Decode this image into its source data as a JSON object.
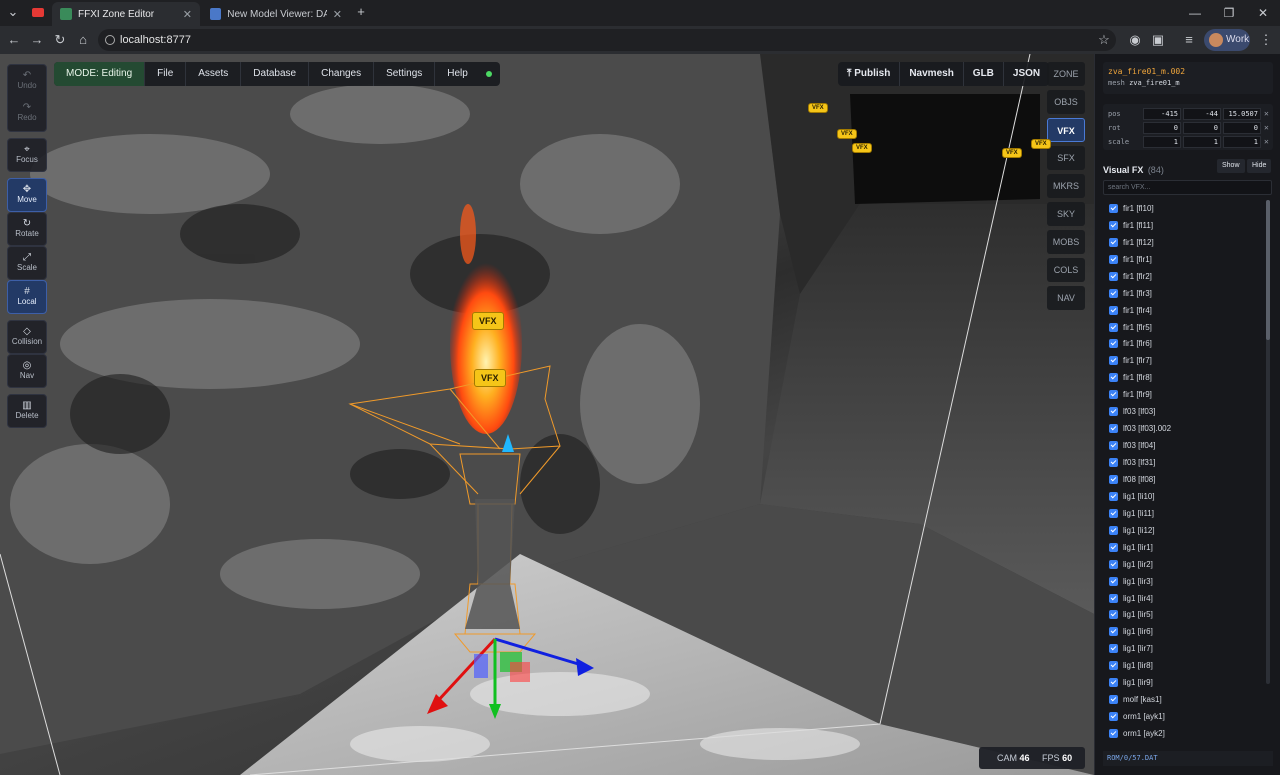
{
  "browser": {
    "tabs": [
      {
        "title": "FFXI Zone Editor",
        "active": true
      },
      {
        "title": "New Model Viewer: DATura - F",
        "active": false
      }
    ],
    "url": "localhost:8777",
    "profile": "Work"
  },
  "tools": {
    "undo": "Undo",
    "redo": "Redo",
    "focus": "Focus",
    "move": "Move",
    "rotate": "Rotate",
    "scale": "Scale",
    "local": "Local",
    "collision": "Collision",
    "nav": "Nav",
    "delete": "Delete"
  },
  "menu": {
    "mode": "MODE: Editing",
    "file": "File",
    "assets": "Assets",
    "database": "Database",
    "changes": "Changes",
    "settings": "Settings",
    "help": "Help"
  },
  "topright": {
    "publish": "Publish",
    "navmesh": "Navmesh",
    "glb": "GLB",
    "json": "JSON"
  },
  "categories": [
    "ZONE",
    "OBJS",
    "VFX",
    "SFX",
    "MKRS",
    "SKY",
    "MOBS",
    "COLS",
    "NAV"
  ],
  "active_category": "VFX",
  "vfx_tag": "VFX",
  "stats": {
    "cam_label": "CAM",
    "cam": "46",
    "fps_label": "FPS",
    "fps": "60"
  },
  "selected": {
    "name": "zva_fire01_m.002",
    "mesh_label": "mesh",
    "mesh": "zva_fire01_m"
  },
  "transform": {
    "pos_label": "pos",
    "pos": [
      "-415",
      "-44",
      "15.0507"
    ],
    "rot_label": "rot",
    "rot": [
      "0",
      "0",
      "0"
    ],
    "scale_label": "scale",
    "scale": [
      "1",
      "1",
      "1"
    ]
  },
  "vfx_panel": {
    "title": "Visual FX",
    "count": "(84)",
    "show": "Show",
    "hide": "Hide",
    "search_placeholder": "search VFX...",
    "items": [
      "fir1 [fl10]",
      "fir1 [fl11]",
      "fir1 [fl12]",
      "fir1 [flr1]",
      "fir1 [flr2]",
      "fir1 [flr3]",
      "fir1 [flr4]",
      "fir1 [flr5]",
      "fir1 [flr6]",
      "fir1 [flr7]",
      "fir1 [flr8]",
      "fir1 [flr9]",
      "lf03 [lf03]",
      "lf03 [lf03].002",
      "lf03 [lf04]",
      "lf03 [lf31]",
      "lf08 [lf08]",
      "lig1 [li10]",
      "lig1 [li11]",
      "lig1 [li12]",
      "lig1 [lir1]",
      "lig1 [lir2]",
      "lig1 [lir3]",
      "lig1 [lir4]",
      "lig1 [lir5]",
      "lig1 [lir6]",
      "lig1 [lir7]",
      "lig1 [lir8]",
      "lig1 [lir9]",
      "molf [kas1]",
      "orm1 [ayk1]",
      "orm1 [ayk2]"
    ]
  },
  "footer_path": "ROM/0/57.DAT"
}
